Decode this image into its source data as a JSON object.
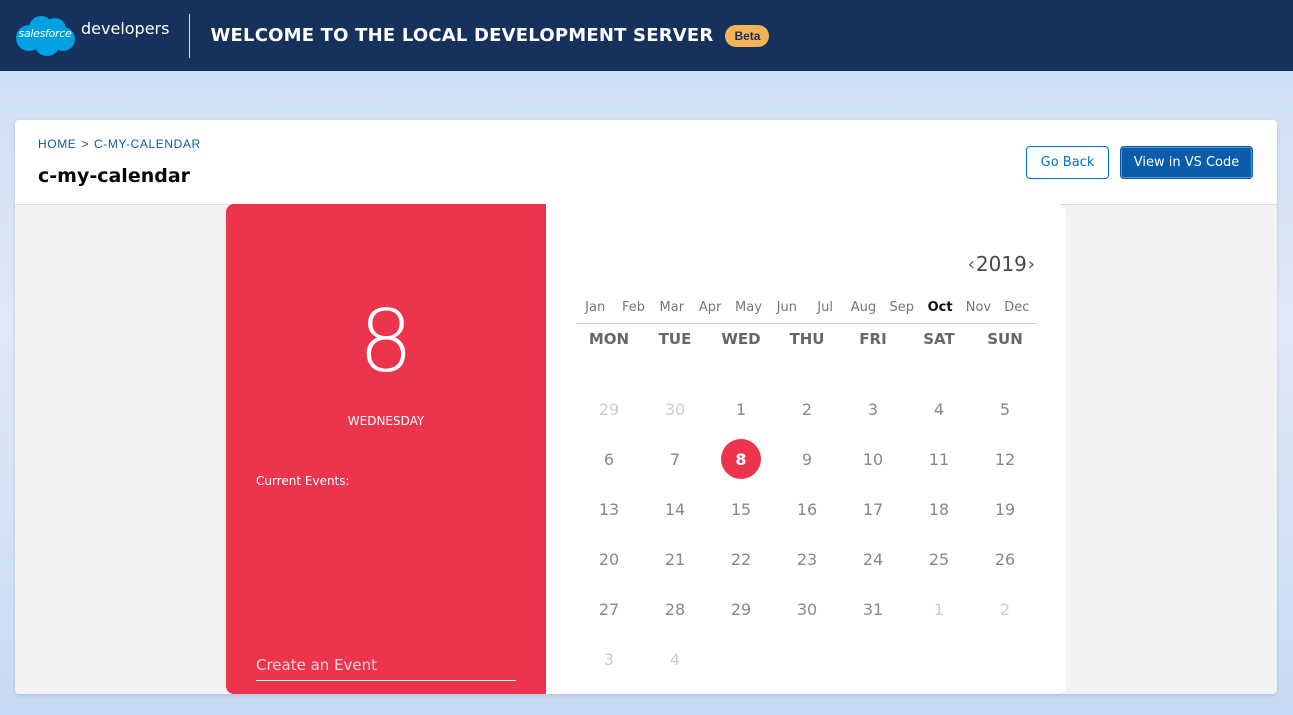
{
  "header": {
    "logo_text": "salesforce",
    "brand_suffix": "developers",
    "banner_title": "Welcome to the Local Development Server",
    "badge": "Beta",
    "bg_color": "#16325c"
  },
  "breadcrumb": {
    "home": "HOME",
    "separator": ">",
    "current": "C-MY-CALENDAR"
  },
  "page": {
    "title": "c-my-calendar"
  },
  "actions": {
    "back": "Go Back",
    "vscode": "View in VS Code"
  },
  "calendar": {
    "selected_day": "8",
    "weekday": "WEDNESDAY",
    "events_label": "Current Events:",
    "create_placeholder": "Create an Event",
    "year": "2019",
    "prev_arrow": "‹",
    "next_arrow": "›",
    "months": [
      "Jan",
      "Feb",
      "Mar",
      "Apr",
      "May",
      "Jun",
      "Jul",
      "Aug",
      "Sep",
      "Oct",
      "Nov",
      "Dec"
    ],
    "active_month": "Oct",
    "weekdays": [
      "MON",
      "TUE",
      "WED",
      "THU",
      "FRI",
      "SAT",
      "SUN"
    ],
    "accent_color": "#ec344c",
    "days": [
      {
        "n": "29",
        "muted": true
      },
      {
        "n": "30",
        "muted": true
      },
      {
        "n": "1"
      },
      {
        "n": "2"
      },
      {
        "n": "3"
      },
      {
        "n": "4"
      },
      {
        "n": "5"
      },
      {
        "n": "6"
      },
      {
        "n": "7"
      },
      {
        "n": "8",
        "selected": true
      },
      {
        "n": "9"
      },
      {
        "n": "10"
      },
      {
        "n": "11"
      },
      {
        "n": "12"
      },
      {
        "n": "13"
      },
      {
        "n": "14"
      },
      {
        "n": "15"
      },
      {
        "n": "16"
      },
      {
        "n": "17"
      },
      {
        "n": "18"
      },
      {
        "n": "19"
      },
      {
        "n": "20"
      },
      {
        "n": "21"
      },
      {
        "n": "22"
      },
      {
        "n": "23"
      },
      {
        "n": "24"
      },
      {
        "n": "25"
      },
      {
        "n": "26"
      },
      {
        "n": "27"
      },
      {
        "n": "28"
      },
      {
        "n": "29"
      },
      {
        "n": "30"
      },
      {
        "n": "31"
      },
      {
        "n": "1",
        "muted": true
      },
      {
        "n": "2",
        "muted": true
      },
      {
        "n": "3",
        "muted": true
      },
      {
        "n": "4",
        "muted": true
      }
    ]
  }
}
